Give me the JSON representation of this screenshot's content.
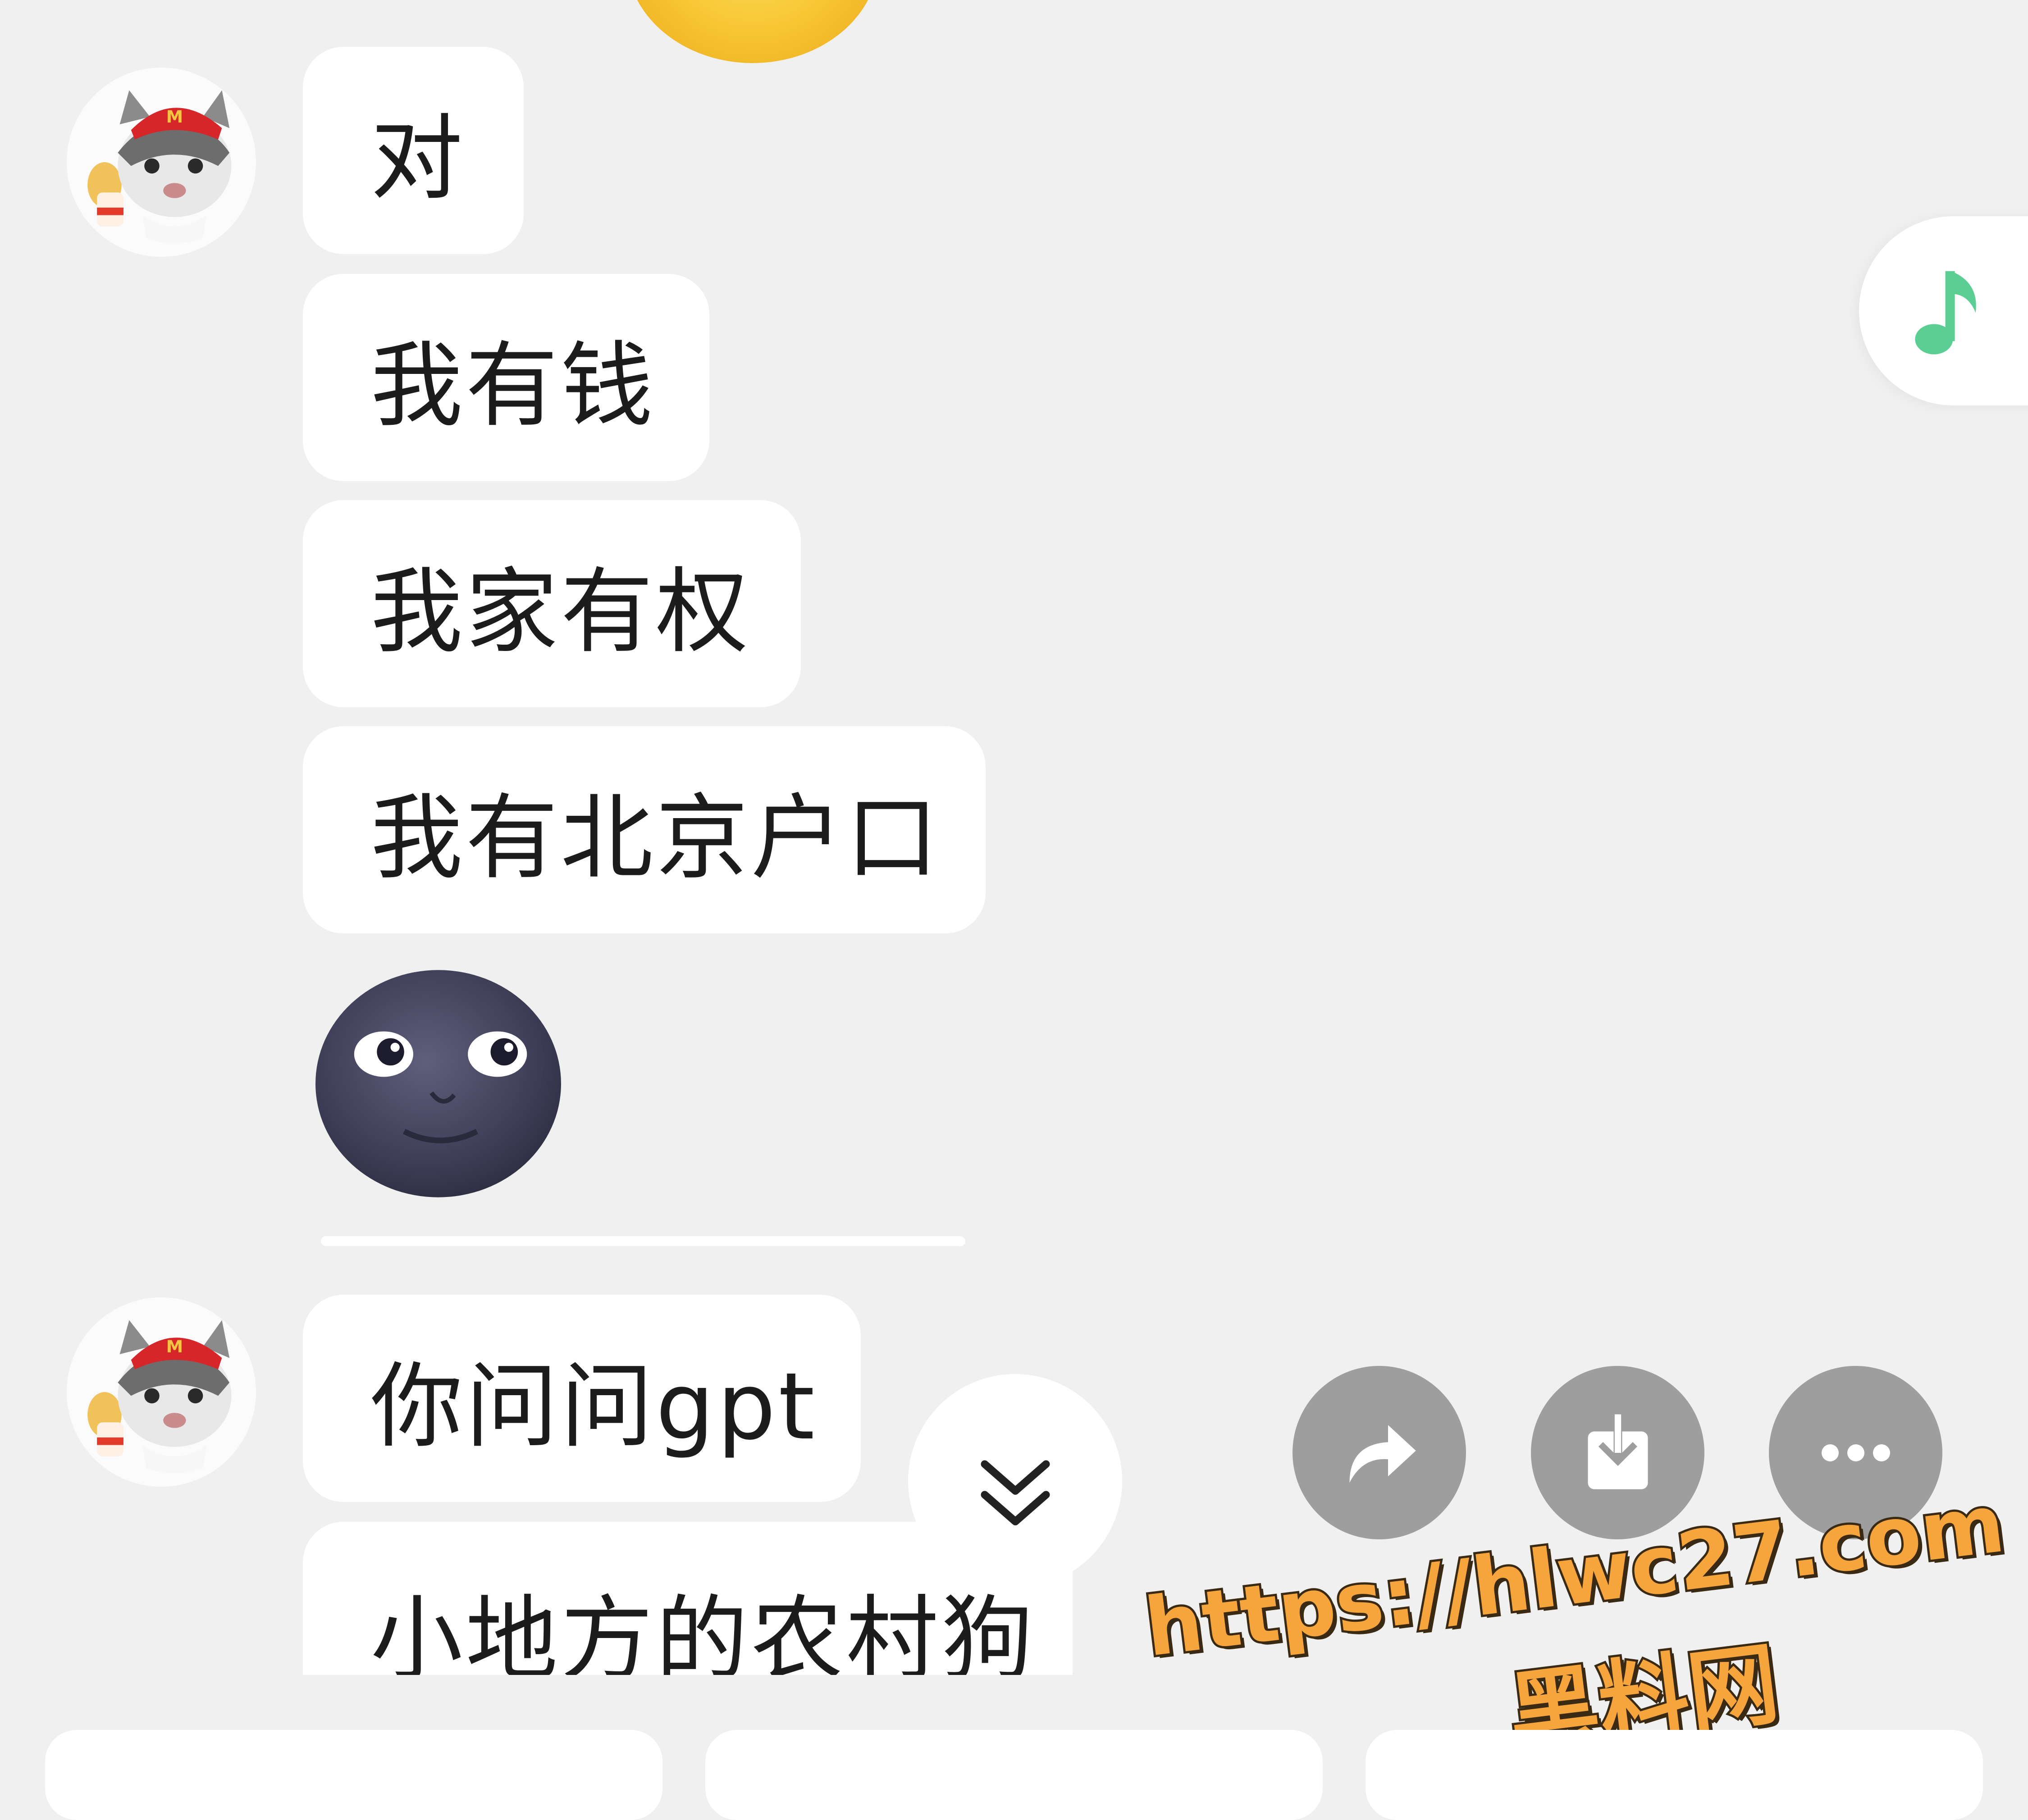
{
  "messages": [
    {
      "text": "对"
    },
    {
      "text": "我有钱"
    },
    {
      "text": "我家有权"
    },
    {
      "text": "我有北京户口"
    },
    {
      "text": "你问问gpt"
    },
    {
      "text": "小地方的农村狗"
    }
  ],
  "watermark": {
    "url": "https://hlwc27.com",
    "name": "黑料网"
  },
  "icons": {
    "music": "music-note-icon",
    "scroll": "double-chevron-down-icon",
    "share": "share-arrow-icon",
    "download": "download-icon",
    "more": "more-dots-icon"
  },
  "colors": {
    "background": "#f0f0f0",
    "bubble": "#ffffff",
    "music_accent": "#5bcf93",
    "action_button": "#9e9e9e",
    "watermark_fill": "#f6a43c"
  }
}
